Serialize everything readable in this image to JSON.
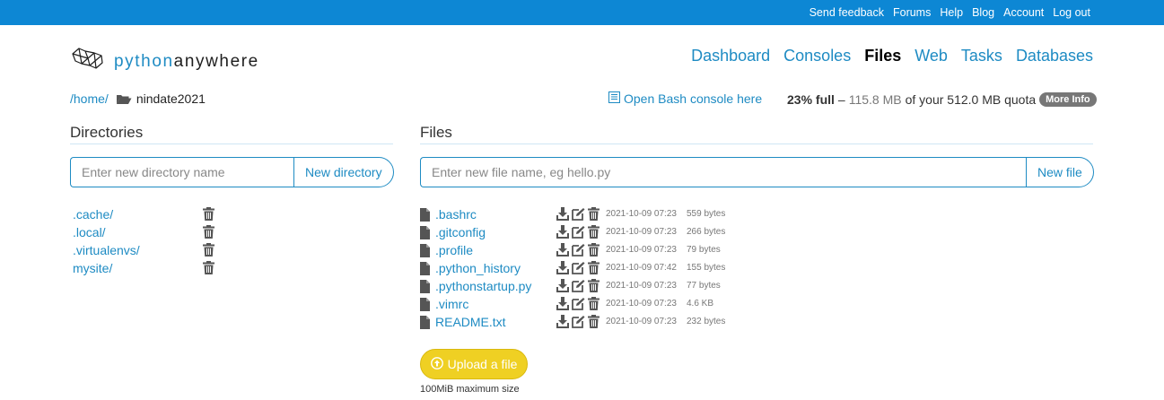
{
  "topbar": {
    "links": [
      "Send feedback",
      "Forums",
      "Help",
      "Blog",
      "Account",
      "Log out"
    ]
  },
  "logo": {
    "prefix": "python",
    "suffix": "anywhere"
  },
  "nav": {
    "items": [
      "Dashboard",
      "Consoles",
      "Files",
      "Web",
      "Tasks",
      "Databases"
    ],
    "active": "Files"
  },
  "breadcrumb": {
    "home": "/home/",
    "current": "nindate2021"
  },
  "bash_link": "Open Bash console here",
  "quota": {
    "percent": "23% full",
    "dash": "–",
    "used": "115.8 MB",
    "of_text": "of your 512.0 MB quota",
    "more_info": "More Info"
  },
  "directories": {
    "title": "Directories",
    "placeholder": "Enter new directory name",
    "button": "New directory",
    "items": [
      ".cache/",
      ".local/",
      ".virtualenvs/",
      "mysite/"
    ]
  },
  "files": {
    "title": "Files",
    "placeholder": "Enter new file name, eg hello.py",
    "button": "New file",
    "items": [
      {
        "name": ".bashrc",
        "date": "2021-10-09 07:23",
        "size": "559 bytes"
      },
      {
        "name": ".gitconfig",
        "date": "2021-10-09 07:23",
        "size": "266 bytes"
      },
      {
        "name": ".profile",
        "date": "2021-10-09 07:23",
        "size": "79 bytes"
      },
      {
        "name": ".python_history",
        "date": "2021-10-09 07:42",
        "size": "155 bytes"
      },
      {
        "name": ".pythonstartup.py",
        "date": "2021-10-09 07:23",
        "size": "77 bytes"
      },
      {
        "name": ".vimrc",
        "date": "2021-10-09 07:23",
        "size": "4.6 KB"
      },
      {
        "name": "README.txt",
        "date": "2021-10-09 07:23",
        "size": "232 bytes"
      }
    ]
  },
  "upload": {
    "label": "Upload a file",
    "max_size": "100MiB maximum size"
  },
  "colors": {
    "brand_blue": "#0d87d4",
    "link_blue": "#1e8bc3",
    "upload_yellow": "#efd023"
  },
  "icons": [
    "logo-icon",
    "folder-open-icon",
    "terminal-icon",
    "trash-icon",
    "file-icon",
    "download-icon",
    "edit-icon",
    "upload-icon"
  ]
}
